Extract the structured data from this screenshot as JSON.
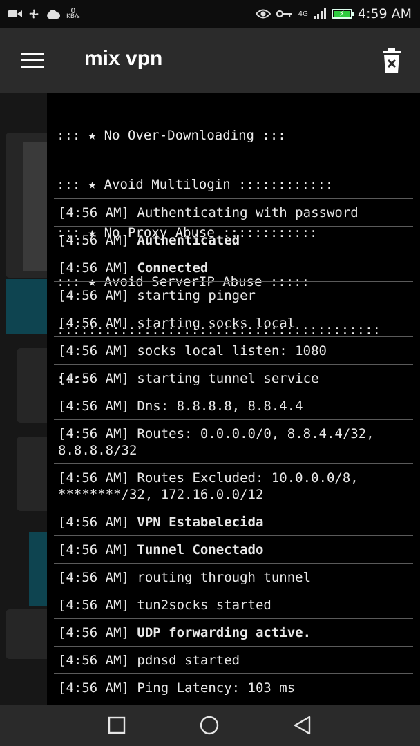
{
  "status_bar": {
    "speed_value": "0",
    "speed_unit": "KB/s",
    "network": "4G",
    "time": "4:59 AM"
  },
  "app_bar": {
    "title": "mix vpn"
  },
  "log": {
    "banner": [
      "::: ★ No Over-Downloading :::",
      "::: ★ Avoid Multilogin ::::::::::::",
      "::: ★ No Proxy Abuse ::::::::::::",
      "::: ★ Avoid ServerIP Abuse :::::",
      ":::::::::::::::::::::::::::::::::::::::::",
      "::::"
    ],
    "entries": [
      {
        "time": "[4:56 AM]",
        "message": "Authenticating with password",
        "bold": false
      },
      {
        "time": "[4:56 AM]",
        "message": "Authenticated",
        "bold": true
      },
      {
        "time": "[4:56 AM]",
        "message": "Connected",
        "bold": true
      },
      {
        "time": "[4:56 AM]",
        "message": "starting pinger",
        "bold": false
      },
      {
        "time": "[4:56 AM]",
        "message": "starting socks local",
        "bold": false
      },
      {
        "time": "[4:56 AM]",
        "message": "socks local listen: 1080",
        "bold": false
      },
      {
        "time": "[4:56 AM]",
        "message": "starting tunnel service",
        "bold": false
      },
      {
        "time": "[4:56 AM]",
        "message": "Dns: 8.8.8.8, 8.8.4.4",
        "bold": false
      },
      {
        "time": "[4:56 AM]",
        "message": "Routes: 0.0.0.0/0, 8.8.4.4/32, 8.8.8.8/32",
        "bold": false
      },
      {
        "time": "[4:56 AM]",
        "message": "Routes Excluded: 10.0.0.0/8, ********/32, 172.16.0.0/12",
        "bold": false
      },
      {
        "time": "[4:56 AM]",
        "message": "VPN Estabelecida",
        "bold": true
      },
      {
        "time": "[4:56 AM]",
        "message": "Tunnel Conectado",
        "bold": true
      },
      {
        "time": "[4:56 AM]",
        "message": "routing through tunnel",
        "bold": false
      },
      {
        "time": "[4:56 AM]",
        "message": "tun2socks started",
        "bold": false
      },
      {
        "time": "[4:56 AM]",
        "message": "UDP forwarding active.",
        "bold": true
      },
      {
        "time": "[4:56 AM]",
        "message": "pdnsd started",
        "bold": false
      },
      {
        "time": "[4:56 AM]",
        "message": "Ping Latency: 103 ms",
        "bold": false
      }
    ]
  },
  "colors": {
    "app_bar": "#2b2b2b",
    "log_background": "#000000",
    "status_bar": "#0d0d0d",
    "battery_fill": "#2ecc40",
    "background_accent": "#0e4450"
  }
}
